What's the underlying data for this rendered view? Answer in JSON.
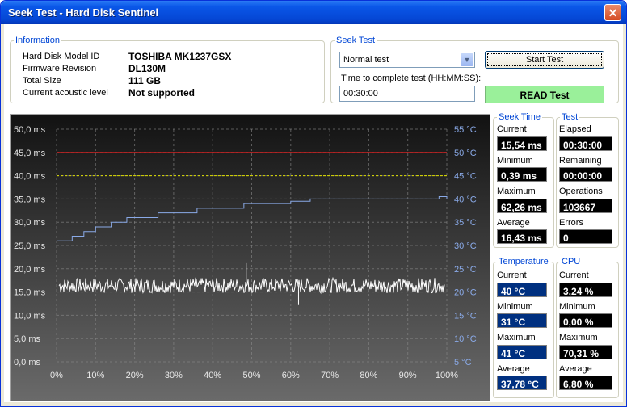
{
  "window": {
    "title": "Seek Test - Hard Disk Sentinel",
    "close_glyph": "✕"
  },
  "information": {
    "legend": "Information",
    "rows": [
      {
        "label": "Hard Disk Model ID",
        "value": "TOSHIBA MK1237GSX"
      },
      {
        "label": "Firmware Revision",
        "value": "DL130M"
      },
      {
        "label": "Total Size",
        "value": "111 GB"
      },
      {
        "label": "Current acoustic level",
        "value": "Not supported"
      }
    ]
  },
  "seek_test": {
    "legend": "Seek Test",
    "mode_selected": "Normal test",
    "time_label": "Time to complete test (HH:MM:SS):",
    "time_value": "00:30:00",
    "start_button": "Start Test",
    "status": "READ Test"
  },
  "graph": {
    "left_axis": [
      "50,0 ms",
      "45,0 ms",
      "40,0 ms",
      "35,0 ms",
      "30,0 ms",
      "25,0 ms",
      "20,0 ms",
      "15,0 ms",
      "10,0 ms",
      "5,0 ms",
      "0,0 ms"
    ],
    "right_axis": [
      "55 °C",
      "50 °C",
      "45 °C",
      "40 °C",
      "35 °C",
      "30 °C",
      "25 °C",
      "20 °C",
      "15 °C",
      "10 °C",
      "5 °C"
    ],
    "x_axis": [
      "0%",
      "10%",
      "20%",
      "30%",
      "40%",
      "50%",
      "60%",
      "70%",
      "80%",
      "90%",
      "100%"
    ],
    "colors": {
      "red_line": "#d02020",
      "yellow_line": "#e0e000",
      "temperature": "#8aaae8",
      "seek": "#ffffff"
    }
  },
  "chart_data": {
    "type": "line",
    "x_unit": "%",
    "xlim": [
      0,
      100
    ],
    "ylim_ms": [
      0,
      50
    ],
    "ylim_temp": [
      5,
      55
    ],
    "reference_lines_ms": [
      45.0,
      40.0
    ],
    "series": [
      {
        "axis": "temperature",
        "x": [
          0,
          3,
          4,
          6,
          7,
          9,
          10,
          12,
          14,
          16,
          18,
          24,
          26,
          30,
          36,
          45,
          48,
          50,
          60,
          65,
          70,
          80,
          90,
          95,
          98,
          100
        ],
        "values": [
          31,
          31,
          32,
          32,
          33,
          33,
          34,
          34,
          35,
          35,
          36,
          36,
          37,
          37,
          38,
          38,
          39,
          39,
          39.5,
          40,
          40,
          40,
          40,
          40,
          40.5,
          40
        ]
      },
      {
        "axis": "seek_time_ms",
        "x": [
          0,
          50,
          100
        ],
        "values": [
          16.4,
          16.4,
          16.4
        ]
      }
    ]
  },
  "seek_time": {
    "legend": "Seek Time",
    "current_label": "Current",
    "current": "15,54 ms",
    "minimum_label": "Minimum",
    "minimum": "0,39 ms",
    "maximum_label": "Maximum",
    "maximum": "62,26 ms",
    "average_label": "Average",
    "average": "16,43 ms"
  },
  "test": {
    "legend": "Test",
    "elapsed_label": "Elapsed",
    "elapsed": "00:30:00",
    "remaining_label": "Remaining",
    "remaining": "00:00:00",
    "operations_label": "Operations",
    "operations": "103667",
    "errors_label": "Errors",
    "errors": "0"
  },
  "temperature": {
    "legend": "Temperature",
    "current_label": "Current",
    "current": "40 °C",
    "minimum_label": "Minimum",
    "minimum": "31 °C",
    "maximum_label": "Maximum",
    "maximum": "41 °C",
    "average_label": "Average",
    "average": "37,78 °C"
  },
  "cpu": {
    "legend": "CPU",
    "current_label": "Current",
    "current": "3,24 %",
    "minimum_label": "Minimum",
    "minimum": "0,00 %",
    "maximum_label": "Maximum",
    "maximum": "70,31 %",
    "average_label": "Average",
    "average": "6,80 %"
  }
}
